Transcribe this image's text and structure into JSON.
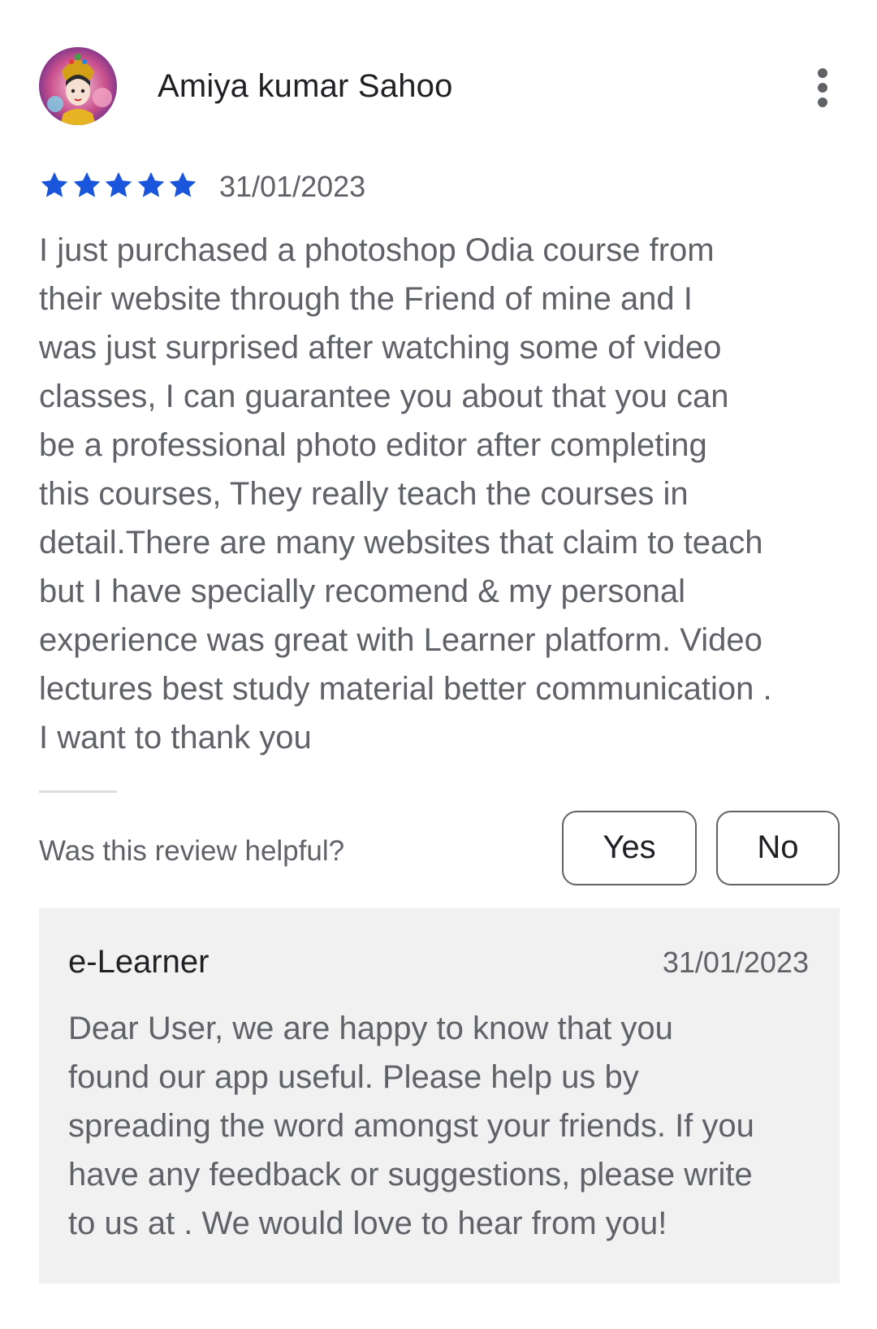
{
  "review": {
    "reviewer_name": "Amiya kumar Sahoo",
    "avatar_icon": "user-avatar-image",
    "menu_icon": "more-vert-icon",
    "rating": 5,
    "rating_max": 5,
    "star_color": "#1a56db",
    "date": "31/01/2023",
    "text_lines": [
      "I just purchased a photoshop Odia course from",
      "their website through the Friend of mine and I",
      "was just surprised after watching some of video",
      "classes, I can guarantee you about that you can",
      "be a professional photo editor after completing",
      "this courses, They really teach the courses in",
      "detail.There are many websites that claim to teach",
      "but I have specially recomend & my personal",
      "experience was great with Learner platform. Video",
      "lectures best study material better communication .",
      "I want to thank you"
    ]
  },
  "helpful": {
    "question": "Was this review helpful?",
    "yes_label": "Yes",
    "no_label": "No"
  },
  "reply": {
    "author": "e-Learner",
    "date": "31/01/2023",
    "text_lines": [
      "Dear User, we are happy to know that you",
      "found our app useful. Please help us by",
      "spreading the word amongst your friends. If you",
      "have any feedback or suggestions, please write",
      "to us at . We would love to hear from you!"
    ]
  }
}
